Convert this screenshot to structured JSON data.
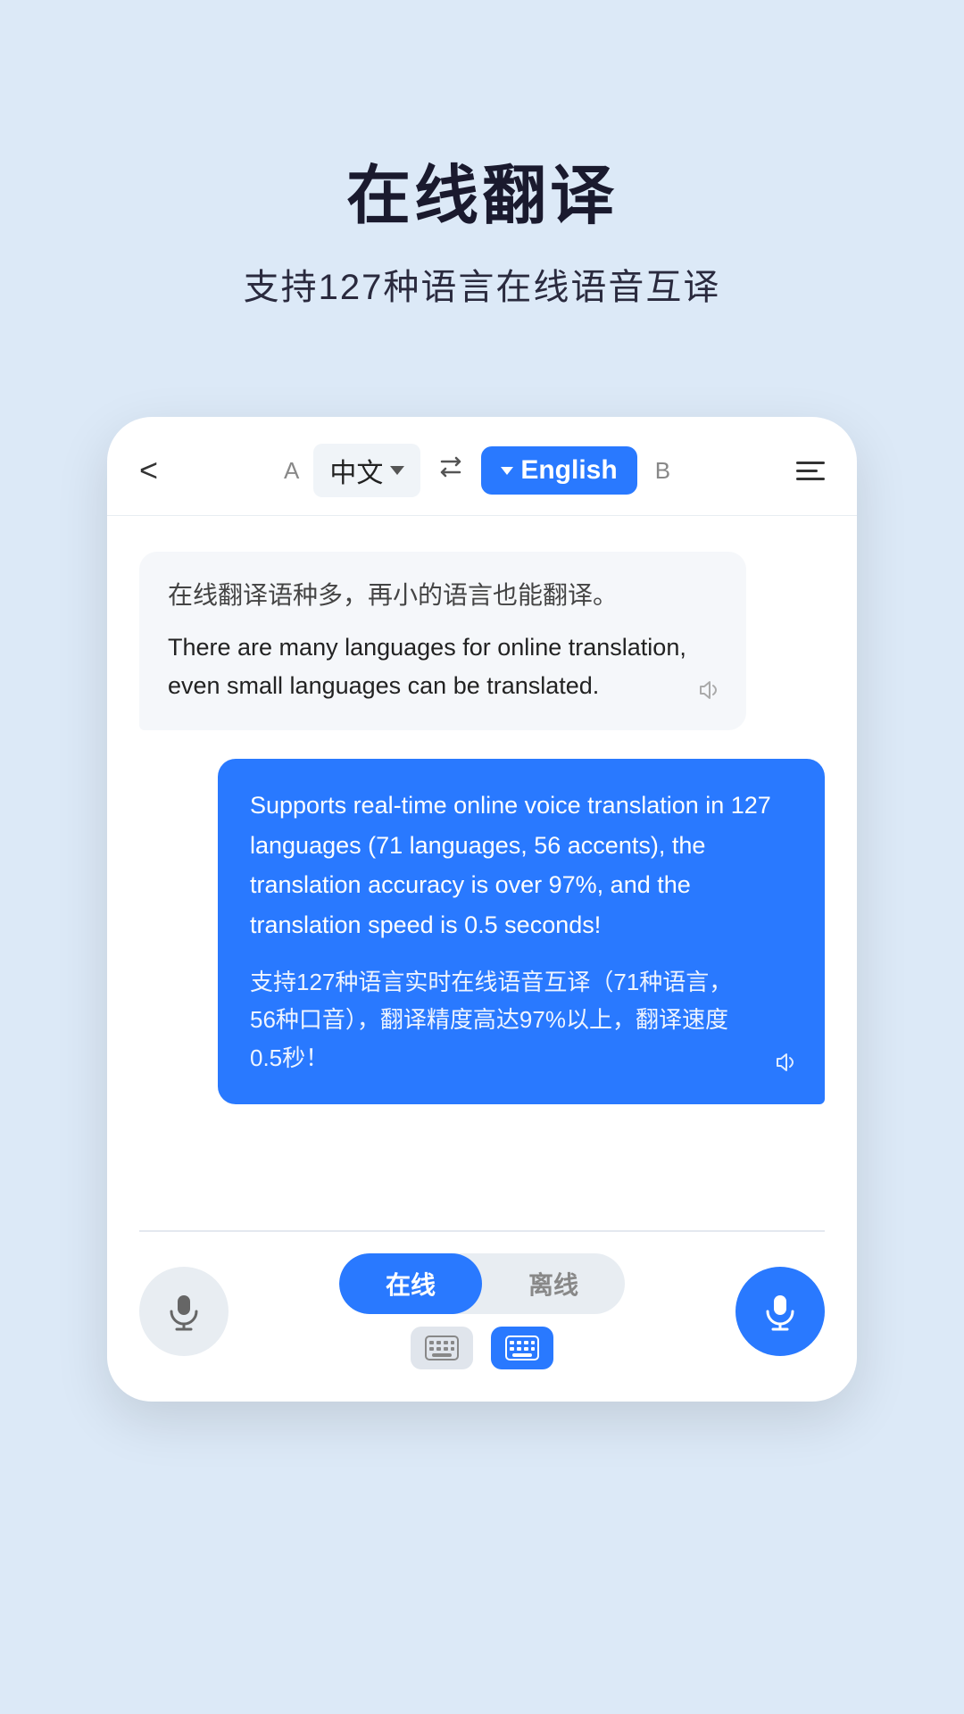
{
  "header": {
    "title": "在线翻译",
    "subtitle": "支持127种语言在线语音互译"
  },
  "nav": {
    "back_label": "<",
    "lang_a_label": "A",
    "lang_source": "中文",
    "swap_label": "⇄",
    "lang_target": "English",
    "lang_b_label": "B"
  },
  "chat": {
    "bubble_left": {
      "original": "在线翻译语种多，再小的语言也能翻译。",
      "translated": "There are many languages for online translation, even small languages can be translated."
    },
    "bubble_right": {
      "english": "Supports real-time online voice translation in 127 languages (71 languages, 56 accents), the translation accuracy is over 97%, and the translation speed is 0.5 seconds!",
      "chinese": "支持127种语言实时在线语音互译（71种语言，56种口音），翻译精度高达97%以上，翻译速度0.5秒！"
    }
  },
  "bottom": {
    "mode_online": "在线",
    "mode_offline": "离线"
  }
}
